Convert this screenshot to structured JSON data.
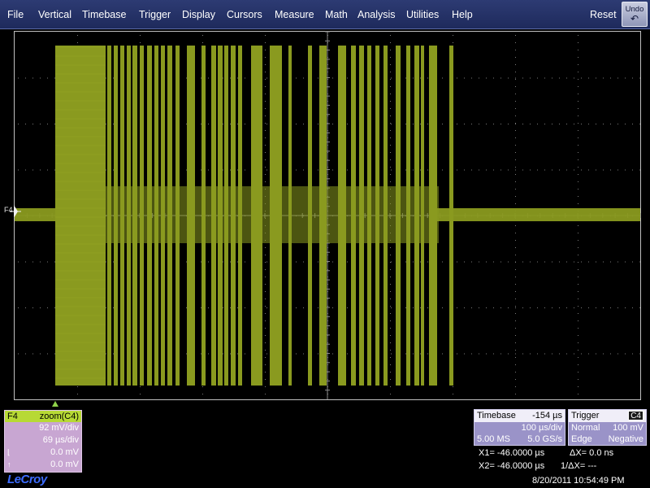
{
  "menu": {
    "items": [
      "File",
      "Vertical",
      "Timebase",
      "Trigger",
      "Display",
      "Cursors",
      "Measure",
      "Math",
      "Analysis",
      "Utilities",
      "Help"
    ],
    "reset_label": "Reset",
    "undo_label": "Undo",
    "undo_icon": "undo-arrow-icon"
  },
  "trace": {
    "label": "F4",
    "color": "#8a9a1f"
  },
  "f4_panel": {
    "name": "F4",
    "source": "zoom(C4)",
    "vdiv": "92 mV/div",
    "tdiv": "69 µs/div",
    "row3_value": "0.0 mV",
    "row4_value": "0.0 mV",
    "head_color": "#b7d935",
    "body_color": "#c8a6d2"
  },
  "timebase": {
    "title": "Timebase",
    "delay": "-154 µs",
    "tdiv": "100 µs/div",
    "samples": "5.00 MS",
    "rate": "5.0 GS/s"
  },
  "trigger": {
    "title": "Trigger",
    "channel": "C4",
    "mode": "Normal",
    "level": "100 mV",
    "type": "Edge",
    "slope": "Negative"
  },
  "cursors": {
    "x1": "X1=  -46.0000 µs",
    "x2": "X2=  -46.0000 µs",
    "dx": "ΔX=  0.0 ns",
    "inv_dx": "1/ΔX=        ---"
  },
  "brand": "LeCroy",
  "datetime": "8/20/2011 10:54:49 PM"
}
